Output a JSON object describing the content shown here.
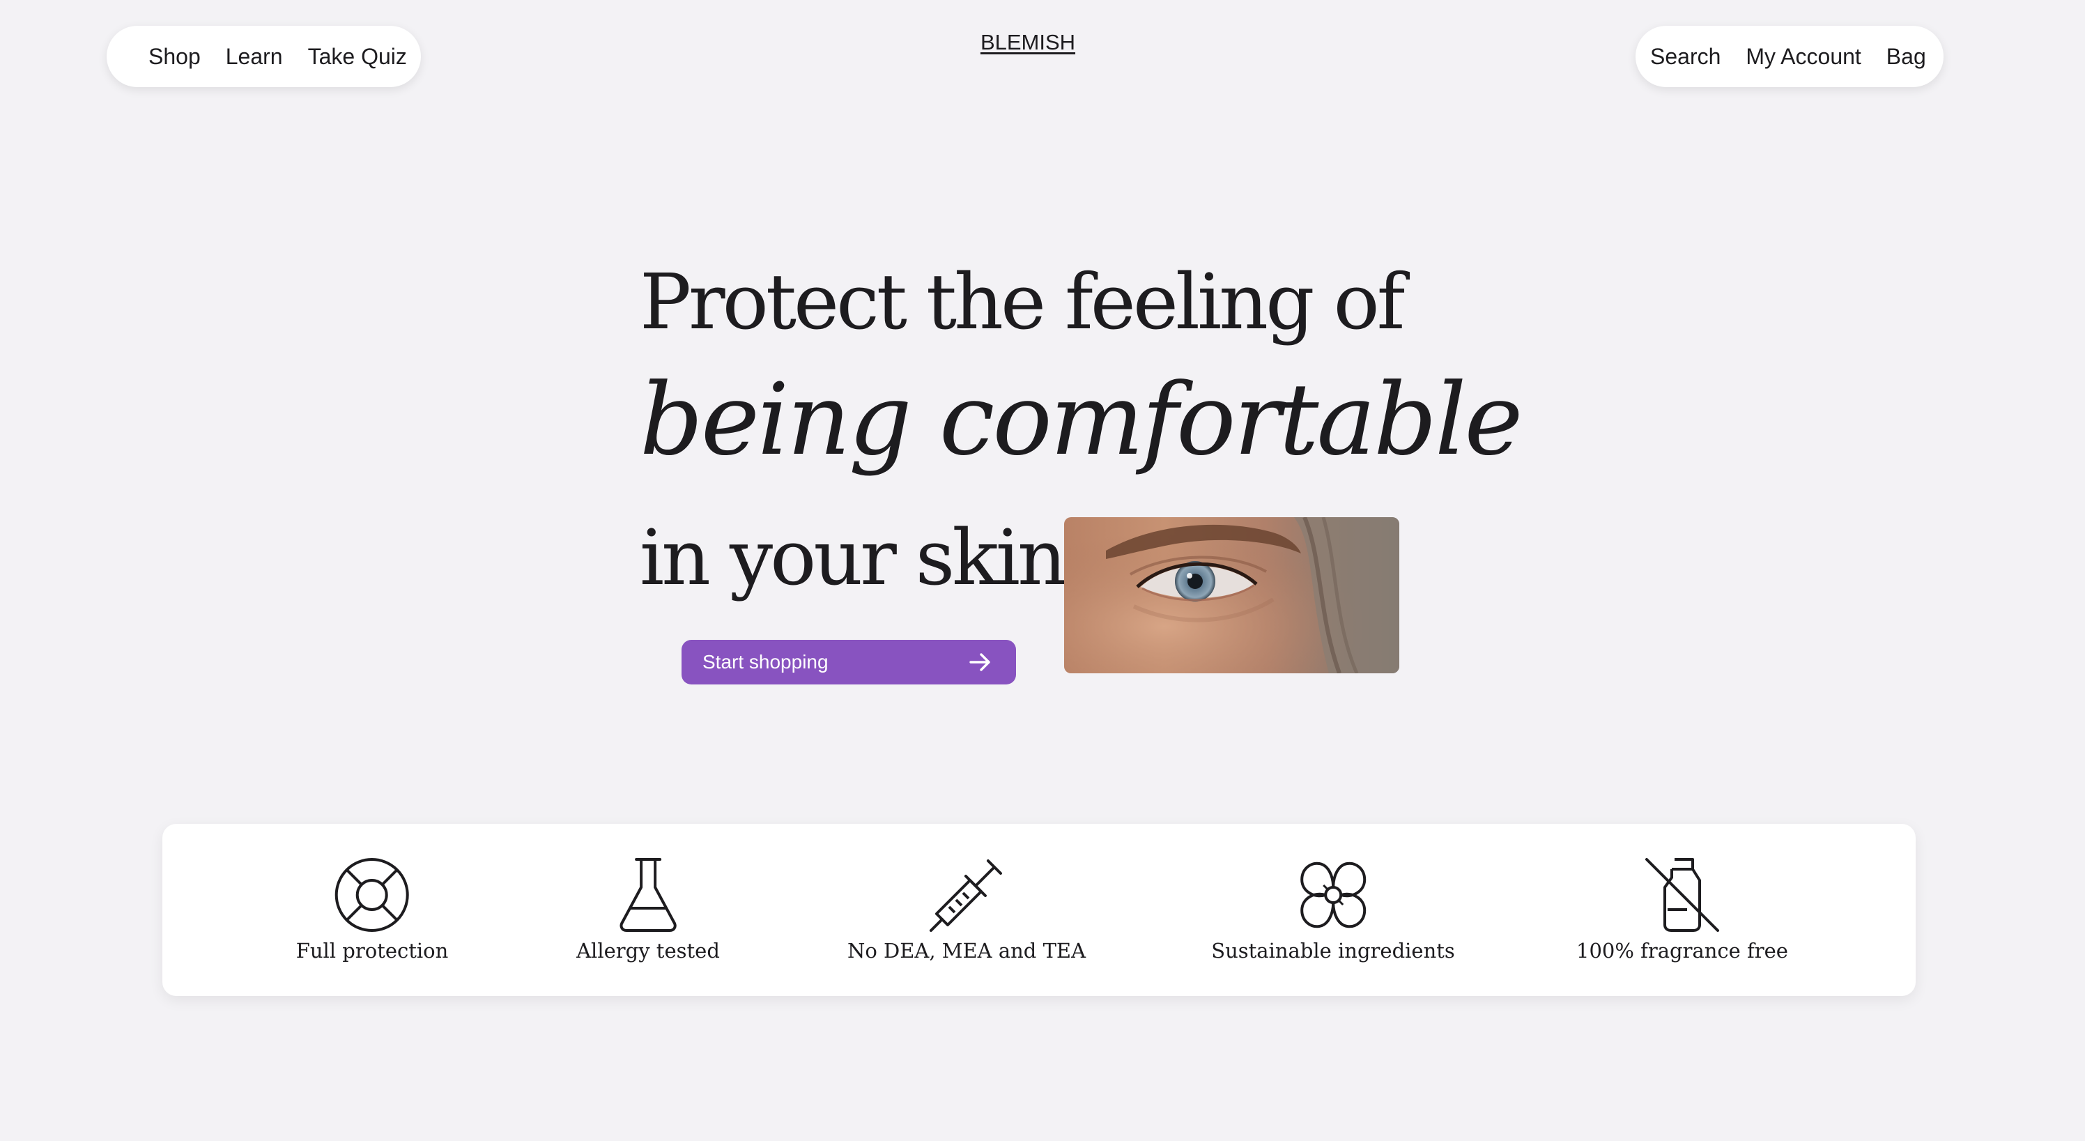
{
  "header": {
    "brand": "BLEMISH",
    "left_nav": [
      {
        "label": "Shop"
      },
      {
        "label": "Learn"
      },
      {
        "label": "Take Quiz"
      }
    ],
    "right_nav": [
      {
        "label": "Search"
      },
      {
        "label": "My Account"
      },
      {
        "label": "Bag"
      }
    ]
  },
  "hero": {
    "line1": "Protect the feeling of",
    "line2": "being comfortable",
    "line3": "in your skin.",
    "cta_label": "Start shopping",
    "cta_icon": "arrow-right-icon",
    "image": "eye-closeup-photo"
  },
  "features": [
    {
      "icon": "lifebuoy-icon",
      "label": "Full protection"
    },
    {
      "icon": "flask-icon",
      "label": "Allergy tested"
    },
    {
      "icon": "syringe-icon",
      "label": "No DEA, MEA and TEA"
    },
    {
      "icon": "flower-icon",
      "label": "Sustainable ingredients"
    },
    {
      "icon": "bottle-crossed-icon",
      "label": "100% fragrance free"
    }
  ],
  "colors": {
    "background": "#f3f2f5",
    "accent": "#8853c0",
    "text": "#1d1c1f",
    "surface": "#ffffff"
  }
}
